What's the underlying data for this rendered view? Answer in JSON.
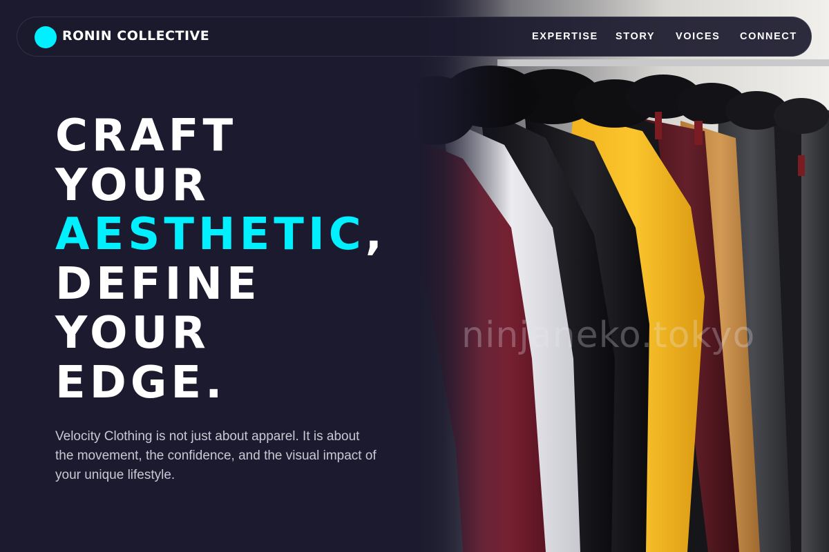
{
  "nav": {
    "brand": "RONIN COLLECTIVE",
    "logo_icon": "cyan-circle-icon",
    "links": [
      {
        "label": "EXPERTISE"
      },
      {
        "label": "STORY"
      },
      {
        "label": "VOICES"
      },
      {
        "label": "CONNECT"
      }
    ]
  },
  "hero": {
    "headline_line1": "CRAFT",
    "headline_line2": "YOUR",
    "headline_accent": "AESTHETIC",
    "headline_comma": ",",
    "headline_line4": "DEFINE",
    "headline_line5": "YOUR",
    "headline_line6": "EDGE.",
    "description": "Velocity Clothing is not just about apparel. It is about the movement, the confidence, and the visual impact of your unique lifestyle.",
    "image_watermark": "ninjaneko.tokyo"
  },
  "colors": {
    "background": "#1b1a2e",
    "accent": "#00f0ff",
    "text": "#ffffff",
    "muted_text": "#c9c9d4"
  }
}
